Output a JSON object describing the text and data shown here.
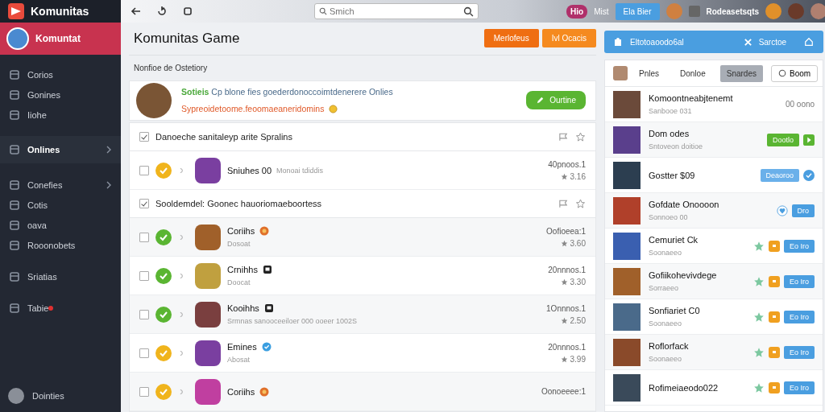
{
  "sidebar": {
    "brand": "Komunitas",
    "user": {
      "name": "Komuntat",
      "selected": true
    },
    "groups": [
      {
        "items": [
          {
            "label": "Corios",
            "selected": false,
            "has_submenu": false
          },
          {
            "label": "Gonines",
            "selected": false,
            "has_submenu": false
          },
          {
            "label": "Iiohe",
            "selected": false,
            "has_submenu": false
          }
        ]
      },
      {
        "items": [
          {
            "label": "Onlines",
            "selected": true,
            "has_submenu": true
          }
        ]
      },
      {
        "items": [
          {
            "label": "Conefies",
            "selected": false,
            "has_submenu": true
          },
          {
            "label": "Cotis",
            "selected": false,
            "has_submenu": false
          },
          {
            "label": "oava",
            "selected": false,
            "has_submenu": false
          },
          {
            "label": "Rooonobets",
            "selected": false,
            "has_submenu": false
          }
        ]
      },
      {
        "items": [
          {
            "label": "Sriatias",
            "selected": false,
            "has_submenu": false
          }
        ]
      },
      {
        "items": [
          {
            "label": "Tabie",
            "selected": false,
            "has_submenu": false,
            "badge": true
          }
        ]
      }
    ],
    "footer": "Dointies"
  },
  "topbar": {
    "search": {
      "placeholder": "Smich"
    },
    "badge": "Hio",
    "link": "Mist",
    "button": "Ela Bier",
    "username": "Rodeasetsqts"
  },
  "main": {
    "title": "Komunitas Game",
    "actions": [
      "Merlofeus",
      "Ivl Ocacis"
    ],
    "subtitle": "Nonfioe de Ostetiory",
    "featured": {
      "tag": "Sotieis",
      "text": "Cp blone fies goederdonoccoimtdenerere Onlies",
      "note": "Sypreoidetoome.feoomaeaneridomins",
      "button": "Ourtine"
    },
    "sections": [
      {
        "title": "Danoeche sanitaleyp arite Spralins",
        "checked": true,
        "rows": [
          {
            "name": "Sniuhes 00",
            "extra": "Monoai tdiddis",
            "count": "40pnoos.1",
            "rating": "3.16",
            "color": "#f0b41c",
            "checked": false
          }
        ]
      },
      {
        "title": "Sooldemdel: Goonec hauoriomaeboortess",
        "checked": true,
        "rows": [
          {
            "name": "Coriihs",
            "sub": "Dosoat",
            "count": "Oofioeea:1",
            "rating": "3.60",
            "color": "#5ab532",
            "kind": "medal",
            "checked": false
          },
          {
            "name": "Crnihhs",
            "sub": "Doocat",
            "count": "20nnnos.1",
            "rating": "3.30",
            "color": "#5ab532",
            "kind": "square",
            "checked": false
          },
          {
            "name": "Kooihhs",
            "sub": "Srmnas sanooceeiloer 000 ooeer 1002S",
            "count": "1Onnnos.1",
            "rating": "2.50",
            "color": "#5ab532",
            "kind": "square",
            "checked": false
          },
          {
            "name": "Emines",
            "sub": "Abosat",
            "count": "20nnnos.1",
            "rating": "3.99",
            "color": "#f0b41c",
            "kind": "verified",
            "checked": false
          },
          {
            "name": "Coriihs",
            "count": "Oonoeeee:1",
            "color": "#f0b41c",
            "kind": "medal",
            "checked": false
          }
        ]
      }
    ]
  },
  "panel": {
    "header": {
      "title": "Eltotoaoodo6al",
      "action": "Sarctoe"
    },
    "tabs": [
      {
        "label": "Pnles",
        "selected": false
      },
      {
        "label": "Donloe",
        "selected": false
      },
      {
        "label": "Snardes",
        "selected": true
      }
    ],
    "tab_button": "Boom",
    "items": [
      {
        "kind": "time",
        "title": "Komoontneabjtenemt",
        "sub": "Sanbooe 031",
        "action": "00 oono"
      },
      {
        "kind": "accept",
        "title": "Dom odes",
        "sub": "Sntoveon doitioe",
        "action": "Dootlo"
      },
      {
        "kind": "confirm",
        "title": "Gostter $09",
        "action": "Deaoroo"
      },
      {
        "kind": "toggle",
        "title": "Gofdate Onoooon",
        "sub": "Sonnoeo 00",
        "action": "Dro"
      },
      {
        "kind": "join",
        "title": "Cemuriet Ck",
        "sub": "Soonaeeo",
        "action": "Eo Iro"
      },
      {
        "kind": "join",
        "title": "Gofiikohevivdege",
        "sub": "Sorraeeo",
        "action": "Eo Iro"
      },
      {
        "kind": "join",
        "title": "Sonfiariet C0",
        "sub": "Soonaeeo",
        "action": "Eo Iro"
      },
      {
        "kind": "join",
        "title": "Roflorfack",
        "sub": "Soonaeeo",
        "action": "Eo Iro"
      },
      {
        "kind": "join",
        "title": "Rofimeiaeodo022",
        "action": "Eo Iro"
      }
    ]
  }
}
